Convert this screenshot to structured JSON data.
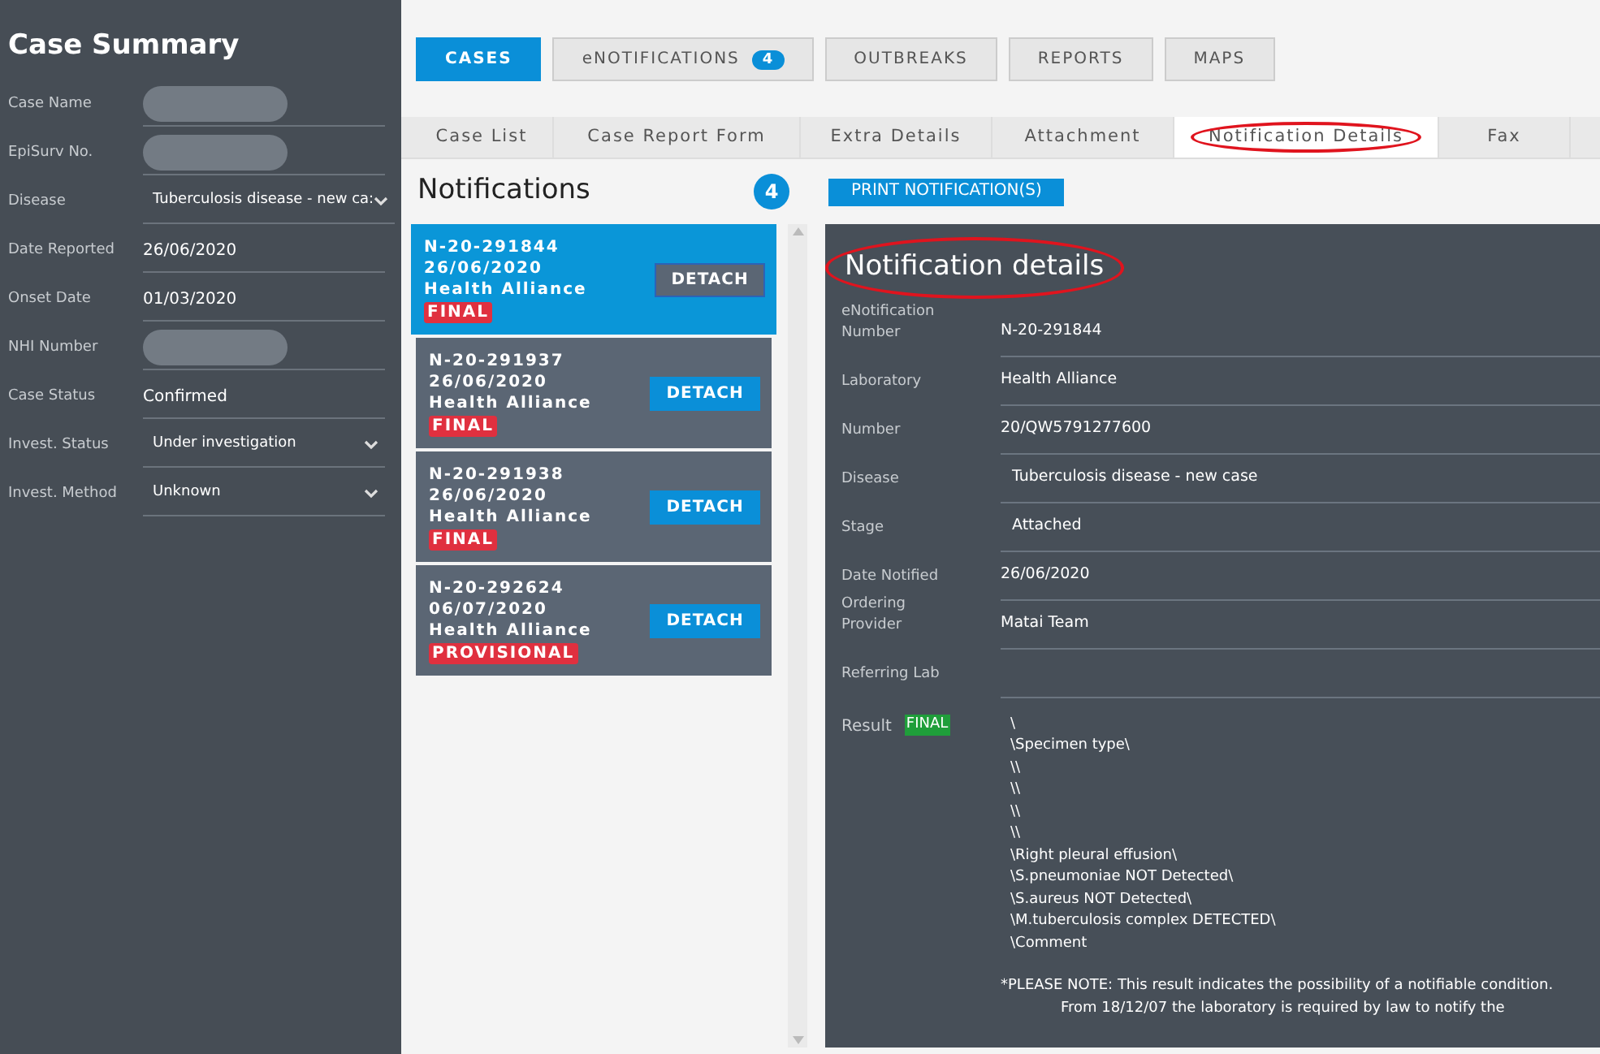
{
  "sidebar": {
    "title": "Case Summary",
    "fields": [
      {
        "label": "Case Name",
        "kind": "redacted"
      },
      {
        "label": "EpiSurv No.",
        "kind": "redacted"
      },
      {
        "label": "Disease",
        "kind": "select",
        "value": "Tuberculosis disease - new ca:"
      },
      {
        "label": "Date Reported",
        "kind": "text",
        "value": "26/06/2020"
      },
      {
        "label": "Onset Date",
        "kind": "text",
        "value": "01/03/2020"
      },
      {
        "label": "NHI Number",
        "kind": "redacted"
      },
      {
        "label": "Case Status",
        "kind": "text",
        "value": "Confirmed"
      },
      {
        "label": "Invest. Status",
        "kind": "select",
        "value": "Under investigation"
      },
      {
        "label": "Invest. Method",
        "kind": "select",
        "value": "Unknown"
      }
    ]
  },
  "nav": [
    {
      "label": "CASES",
      "selected": true
    },
    {
      "label": "eNOTIFICATIONS",
      "selected": false,
      "badge": "4"
    },
    {
      "label": "OUTBREAKS",
      "selected": false
    },
    {
      "label": "REPORTS",
      "selected": false
    },
    {
      "label": "MAPS",
      "selected": false
    }
  ],
  "tabs": [
    {
      "label": "Case List",
      "selected": false
    },
    {
      "label": "Case Report Form",
      "selected": false
    },
    {
      "label": "Extra Details",
      "selected": false
    },
    {
      "label": "Attachment",
      "selected": false
    },
    {
      "label": "Notification Details",
      "selected": true,
      "circled": true
    },
    {
      "label": "Fax",
      "selected": false
    }
  ],
  "notifications": {
    "title": "Notifications",
    "count": "4",
    "items": [
      {
        "number": "N-20-291844",
        "date": "26/06/2020",
        "lab": "Health Alliance",
        "status": "FINAL",
        "button": "DETACH",
        "selected": true
      },
      {
        "number": "N-20-291937",
        "date": "26/06/2020",
        "lab": "Health Alliance",
        "status": "FINAL",
        "button": "DETACH",
        "selected": false
      },
      {
        "number": "N-20-291938",
        "date": "26/06/2020",
        "lab": "Health Alliance",
        "status": "FINAL",
        "button": "DETACH",
        "selected": false
      },
      {
        "number": "N-20-292624",
        "date": "06/07/2020",
        "lab": "Health Alliance",
        "status": "PROVISIONAL",
        "button": "DETACH",
        "selected": false
      }
    ]
  },
  "details": {
    "print_button": "PRINT NOTIFICATION(S)",
    "title": "Notification details",
    "title_circled": true,
    "fields": [
      {
        "label": "eNotification Number",
        "value": "N-20-291844",
        "indented": false
      },
      {
        "label": "Laboratory",
        "value": "Health Alliance",
        "indented": false
      },
      {
        "label": "Number",
        "value": "20/QW5791277600",
        "indented": false
      },
      {
        "label": "Disease",
        "value": "Tuberculosis disease - new case",
        "indented": true
      },
      {
        "label": "Stage",
        "value": "Attached",
        "indented": true
      },
      {
        "label": "Date Notified",
        "value": "26/06/2020",
        "indented": false
      },
      {
        "label": "Ordering Provider",
        "value": "Matai Team",
        "indented": false
      },
      {
        "label": "Referring Lab"
      }
    ],
    "result": {
      "label": "Result",
      "badge": "FINAL",
      "lines": [
        "\\",
        "\\Specimen type\\",
        "\\\\",
        "\\\\",
        "\\\\",
        "\\\\",
        "\\Right pleural effusion\\",
        "\\S.pneumoniae NOT Detected\\",
        "\\S.aureus NOT Detected\\",
        "\\M.tuberculosis complex DETECTED\\",
        "\\Comment"
      ],
      "note": "*PLEASE NOTE: This result indicates the possibility of a notifiable condition.",
      "note_continued": "From 18/12/07 the laboratory is required by law to notify the"
    }
  }
}
